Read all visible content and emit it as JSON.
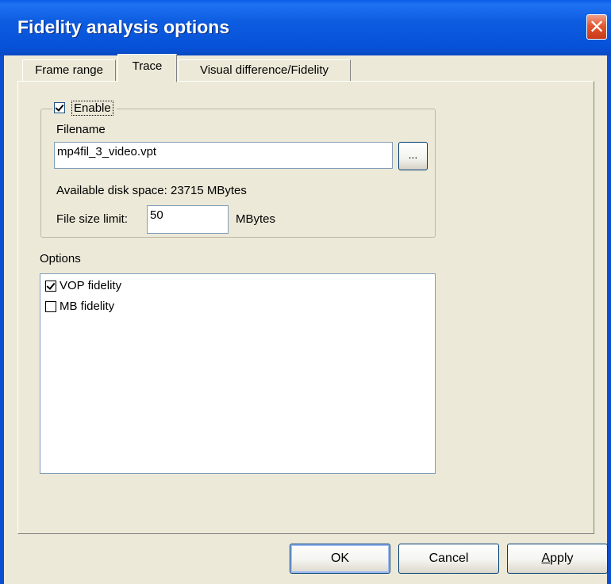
{
  "window": {
    "title": "Fidelity analysis options",
    "close_glyph": "✕"
  },
  "tabs": [
    {
      "label": "Frame range",
      "selected": false
    },
    {
      "label": "Trace",
      "selected": true
    },
    {
      "label": "Visual difference/Fidelity",
      "selected": false
    }
  ],
  "trace": {
    "enable": {
      "label": "Enable",
      "checked": true
    },
    "filename_label": "Filename",
    "filename_value": "mp4fil_3_video.vpt",
    "browse_label": "...",
    "disk_space_text": "Available disk space: 23715 MBytes",
    "file_size_limit_label": "File size limit:",
    "file_size_limit_value": "50",
    "file_size_unit": "MBytes"
  },
  "options": {
    "label": "Options",
    "items": [
      {
        "label": "VOP fidelity",
        "checked": true
      },
      {
        "label": "MB fidelity",
        "checked": false
      }
    ]
  },
  "buttons": {
    "ok": "OK",
    "cancel": "Cancel",
    "apply": "Apply"
  },
  "colors": {
    "titlebar": "#0A5BE8",
    "dialog_bg": "#ECE9D8",
    "close_button": "#E3572F"
  }
}
